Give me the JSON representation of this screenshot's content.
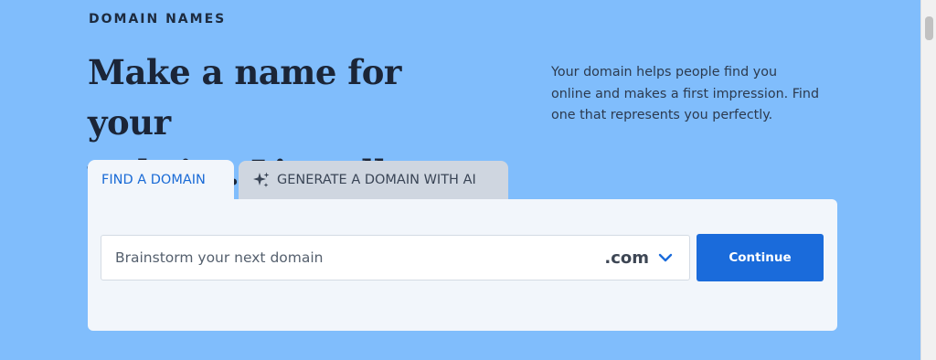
{
  "eyebrow": "DOMAIN NAMES",
  "headline": {
    "line1": "Make a name for your",
    "line2": "website. Literally."
  },
  "blurb": {
    "line1": "Your domain helps people find you",
    "line2": "online and makes a first impression. Find",
    "line3": "one that represents you perfectly."
  },
  "tabs": [
    {
      "label": "FIND A DOMAIN",
      "active": true
    },
    {
      "label": "GENERATE A DOMAIN WITH AI",
      "icon": "sparkle-icon",
      "active": false
    }
  ],
  "search": {
    "placeholder": "Brainstorm your next domain",
    "value": "",
    "tld": ".com"
  },
  "continue_label": "Continue",
  "colors": {
    "background": "#80bdfc",
    "accent": "#1a6bdb",
    "panel": "#f2f6fb"
  }
}
